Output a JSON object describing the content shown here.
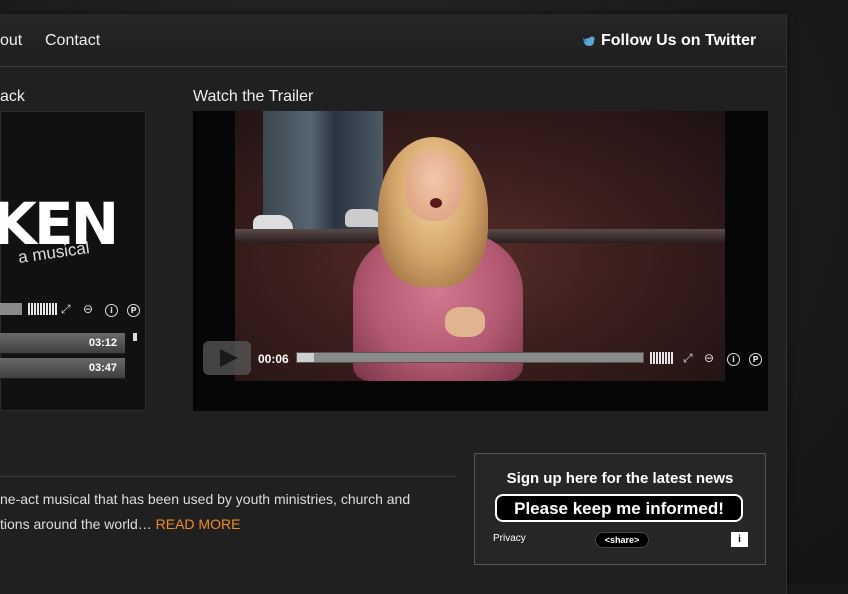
{
  "nav": {
    "items": [
      {
        "label": "out"
      },
      {
        "label": "Contact"
      }
    ],
    "twitter_label": "Follow Us on Twitter"
  },
  "audio": {
    "section_title": "ack",
    "logo_text": "KEN",
    "logo_subtext": "a musical",
    "tracks": [
      {
        "time": "03:12"
      },
      {
        "time": "03:47"
      }
    ]
  },
  "video": {
    "section_title": "Watch the Trailer",
    "current_time": "00:06",
    "progress": 0.05
  },
  "description": {
    "line1": "ne-act musical that has been used by youth ministries, church and",
    "line2": "tions around the world… ",
    "read_more": "READ MORE"
  },
  "signup": {
    "title": "Sign up here for the latest news",
    "button_label": "Please keep me informed!",
    "privacy_label": "Privacy",
    "share_label": "<share>",
    "info_label": "i"
  }
}
